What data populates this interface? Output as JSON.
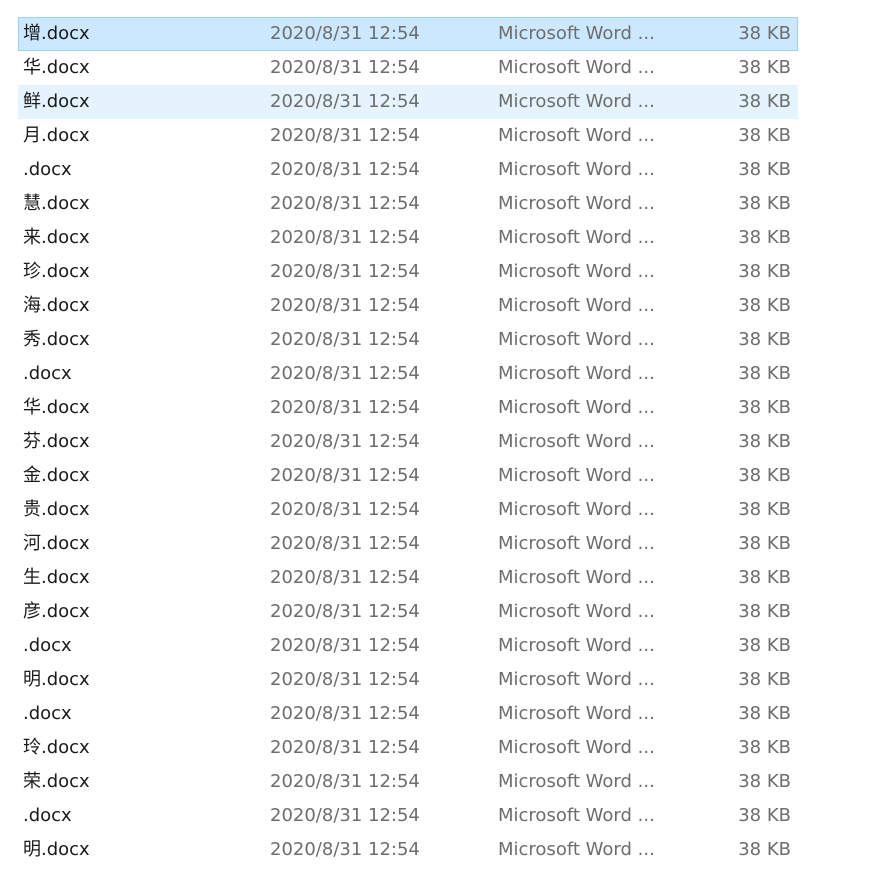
{
  "files": [
    {
      "name": "增.docx",
      "modified": "2020/8/31 12:54",
      "type": "Microsoft Word ...",
      "size": "38 KB",
      "state": "selected"
    },
    {
      "name": "华.docx",
      "modified": "2020/8/31 12:54",
      "type": "Microsoft Word ...",
      "size": "38 KB",
      "state": ""
    },
    {
      "name": "鲜.docx",
      "modified": "2020/8/31 12:54",
      "type": "Microsoft Word ...",
      "size": "38 KB",
      "state": "hover"
    },
    {
      "name": "月.docx",
      "modified": "2020/8/31 12:54",
      "type": "Microsoft Word ...",
      "size": "38 KB",
      "state": ""
    },
    {
      "name": ".docx",
      "modified": "2020/8/31 12:54",
      "type": "Microsoft Word ...",
      "size": "38 KB",
      "state": ""
    },
    {
      "name": "慧.docx",
      "modified": "2020/8/31 12:54",
      "type": "Microsoft Word ...",
      "size": "38 KB",
      "state": ""
    },
    {
      "name": "来.docx",
      "modified": "2020/8/31 12:54",
      "type": "Microsoft Word ...",
      "size": "38 KB",
      "state": ""
    },
    {
      "name": "珍.docx",
      "modified": "2020/8/31 12:54",
      "type": "Microsoft Word ...",
      "size": "38 KB",
      "state": ""
    },
    {
      "name": "海.docx",
      "modified": "2020/8/31 12:54",
      "type": "Microsoft Word ...",
      "size": "38 KB",
      "state": ""
    },
    {
      "name": "秀.docx",
      "modified": "2020/8/31 12:54",
      "type": "Microsoft Word ...",
      "size": "38 KB",
      "state": ""
    },
    {
      "name": ".docx",
      "modified": "2020/8/31 12:54",
      "type": "Microsoft Word ...",
      "size": "38 KB",
      "state": ""
    },
    {
      "name": "华.docx",
      "modified": "2020/8/31 12:54",
      "type": "Microsoft Word ...",
      "size": "38 KB",
      "state": ""
    },
    {
      "name": "芬.docx",
      "modified": "2020/8/31 12:54",
      "type": "Microsoft Word ...",
      "size": "38 KB",
      "state": ""
    },
    {
      "name": "金.docx",
      "modified": "2020/8/31 12:54",
      "type": "Microsoft Word ...",
      "size": "38 KB",
      "state": ""
    },
    {
      "name": "贵.docx",
      "modified": "2020/8/31 12:54",
      "type": "Microsoft Word ...",
      "size": "38 KB",
      "state": ""
    },
    {
      "name": "河.docx",
      "modified": "2020/8/31 12:54",
      "type": "Microsoft Word ...",
      "size": "38 KB",
      "state": ""
    },
    {
      "name": "生.docx",
      "modified": "2020/8/31 12:54",
      "type": "Microsoft Word ...",
      "size": "38 KB",
      "state": ""
    },
    {
      "name": "彦.docx",
      "modified": "2020/8/31 12:54",
      "type": "Microsoft Word ...",
      "size": "38 KB",
      "state": ""
    },
    {
      "name": ".docx",
      "modified": "2020/8/31 12:54",
      "type": "Microsoft Word ...",
      "size": "38 KB",
      "state": ""
    },
    {
      "name": "明.docx",
      "modified": "2020/8/31 12:54",
      "type": "Microsoft Word ...",
      "size": "38 KB",
      "state": ""
    },
    {
      "name": ".docx",
      "modified": "2020/8/31 12:54",
      "type": "Microsoft Word ...",
      "size": "38 KB",
      "state": ""
    },
    {
      "name": "玲.docx",
      "modified": "2020/8/31 12:54",
      "type": "Microsoft Word ...",
      "size": "38 KB",
      "state": ""
    },
    {
      "name": "荣.docx",
      "modified": "2020/8/31 12:54",
      "type": "Microsoft Word ...",
      "size": "38 KB",
      "state": ""
    },
    {
      "name": ".docx",
      "modified": "2020/8/31 12:54",
      "type": "Microsoft Word ...",
      "size": "38 KB",
      "state": ""
    },
    {
      "name": "明.docx",
      "modified": "2020/8/31 12:54",
      "type": "Microsoft Word ...",
      "size": "38 KB",
      "state": ""
    }
  ],
  "colors": {
    "selected_background": "#cce8ff",
    "selected_border": "#99d1ff",
    "hover_background": "#e5f3ff",
    "name_text": "#1a1a1a",
    "detail_text": "#6d6d6d"
  }
}
